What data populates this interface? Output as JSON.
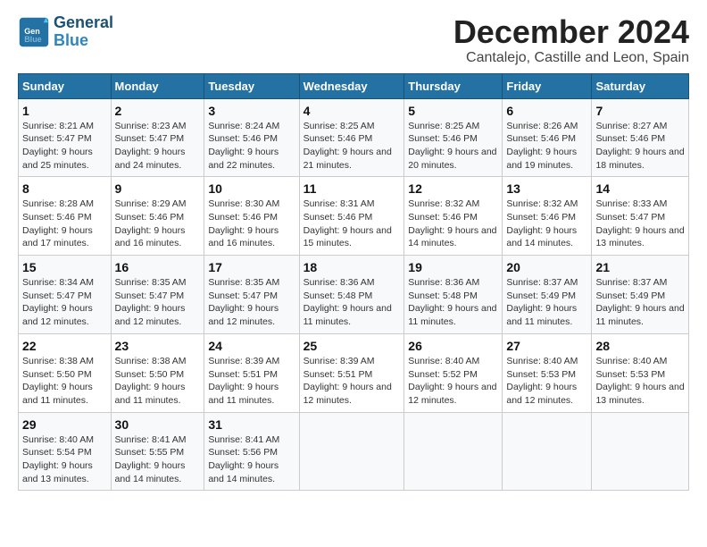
{
  "header": {
    "logo_general": "General",
    "logo_blue": "Blue",
    "month_title": "December 2024",
    "location": "Cantalejo, Castille and Leon, Spain"
  },
  "days_of_week": [
    "Sunday",
    "Monday",
    "Tuesday",
    "Wednesday",
    "Thursday",
    "Friday",
    "Saturday"
  ],
  "weeks": [
    [
      {
        "num": "1",
        "sunrise": "8:21 AM",
        "sunset": "5:47 PM",
        "daylight": "9 hours and 25 minutes."
      },
      {
        "num": "2",
        "sunrise": "8:23 AM",
        "sunset": "5:47 PM",
        "daylight": "9 hours and 24 minutes."
      },
      {
        "num": "3",
        "sunrise": "8:24 AM",
        "sunset": "5:46 PM",
        "daylight": "9 hours and 22 minutes."
      },
      {
        "num": "4",
        "sunrise": "8:25 AM",
        "sunset": "5:46 PM",
        "daylight": "9 hours and 21 minutes."
      },
      {
        "num": "5",
        "sunrise": "8:25 AM",
        "sunset": "5:46 PM",
        "daylight": "9 hours and 20 minutes."
      },
      {
        "num": "6",
        "sunrise": "8:26 AM",
        "sunset": "5:46 PM",
        "daylight": "9 hours and 19 minutes."
      },
      {
        "num": "7",
        "sunrise": "8:27 AM",
        "sunset": "5:46 PM",
        "daylight": "9 hours and 18 minutes."
      }
    ],
    [
      {
        "num": "8",
        "sunrise": "8:28 AM",
        "sunset": "5:46 PM",
        "daylight": "9 hours and 17 minutes."
      },
      {
        "num": "9",
        "sunrise": "8:29 AM",
        "sunset": "5:46 PM",
        "daylight": "9 hours and 16 minutes."
      },
      {
        "num": "10",
        "sunrise": "8:30 AM",
        "sunset": "5:46 PM",
        "daylight": "9 hours and 16 minutes."
      },
      {
        "num": "11",
        "sunrise": "8:31 AM",
        "sunset": "5:46 PM",
        "daylight": "9 hours and 15 minutes."
      },
      {
        "num": "12",
        "sunrise": "8:32 AM",
        "sunset": "5:46 PM",
        "daylight": "9 hours and 14 minutes."
      },
      {
        "num": "13",
        "sunrise": "8:32 AM",
        "sunset": "5:46 PM",
        "daylight": "9 hours and 14 minutes."
      },
      {
        "num": "14",
        "sunrise": "8:33 AM",
        "sunset": "5:47 PM",
        "daylight": "9 hours and 13 minutes."
      }
    ],
    [
      {
        "num": "15",
        "sunrise": "8:34 AM",
        "sunset": "5:47 PM",
        "daylight": "9 hours and 12 minutes."
      },
      {
        "num": "16",
        "sunrise": "8:35 AM",
        "sunset": "5:47 PM",
        "daylight": "9 hours and 12 minutes."
      },
      {
        "num": "17",
        "sunrise": "8:35 AM",
        "sunset": "5:47 PM",
        "daylight": "9 hours and 12 minutes."
      },
      {
        "num": "18",
        "sunrise": "8:36 AM",
        "sunset": "5:48 PM",
        "daylight": "9 hours and 11 minutes."
      },
      {
        "num": "19",
        "sunrise": "8:36 AM",
        "sunset": "5:48 PM",
        "daylight": "9 hours and 11 minutes."
      },
      {
        "num": "20",
        "sunrise": "8:37 AM",
        "sunset": "5:49 PM",
        "daylight": "9 hours and 11 minutes."
      },
      {
        "num": "21",
        "sunrise": "8:37 AM",
        "sunset": "5:49 PM",
        "daylight": "9 hours and 11 minutes."
      }
    ],
    [
      {
        "num": "22",
        "sunrise": "8:38 AM",
        "sunset": "5:50 PM",
        "daylight": "9 hours and 11 minutes."
      },
      {
        "num": "23",
        "sunrise": "8:38 AM",
        "sunset": "5:50 PM",
        "daylight": "9 hours and 11 minutes."
      },
      {
        "num": "24",
        "sunrise": "8:39 AM",
        "sunset": "5:51 PM",
        "daylight": "9 hours and 11 minutes."
      },
      {
        "num": "25",
        "sunrise": "8:39 AM",
        "sunset": "5:51 PM",
        "daylight": "9 hours and 12 minutes."
      },
      {
        "num": "26",
        "sunrise": "8:40 AM",
        "sunset": "5:52 PM",
        "daylight": "9 hours and 12 minutes."
      },
      {
        "num": "27",
        "sunrise": "8:40 AM",
        "sunset": "5:53 PM",
        "daylight": "9 hours and 12 minutes."
      },
      {
        "num": "28",
        "sunrise": "8:40 AM",
        "sunset": "5:53 PM",
        "daylight": "9 hours and 13 minutes."
      }
    ],
    [
      {
        "num": "29",
        "sunrise": "8:40 AM",
        "sunset": "5:54 PM",
        "daylight": "9 hours and 13 minutes."
      },
      {
        "num": "30",
        "sunrise": "8:41 AM",
        "sunset": "5:55 PM",
        "daylight": "9 hours and 14 minutes."
      },
      {
        "num": "31",
        "sunrise": "8:41 AM",
        "sunset": "5:56 PM",
        "daylight": "9 hours and 14 minutes."
      },
      null,
      null,
      null,
      null
    ]
  ]
}
